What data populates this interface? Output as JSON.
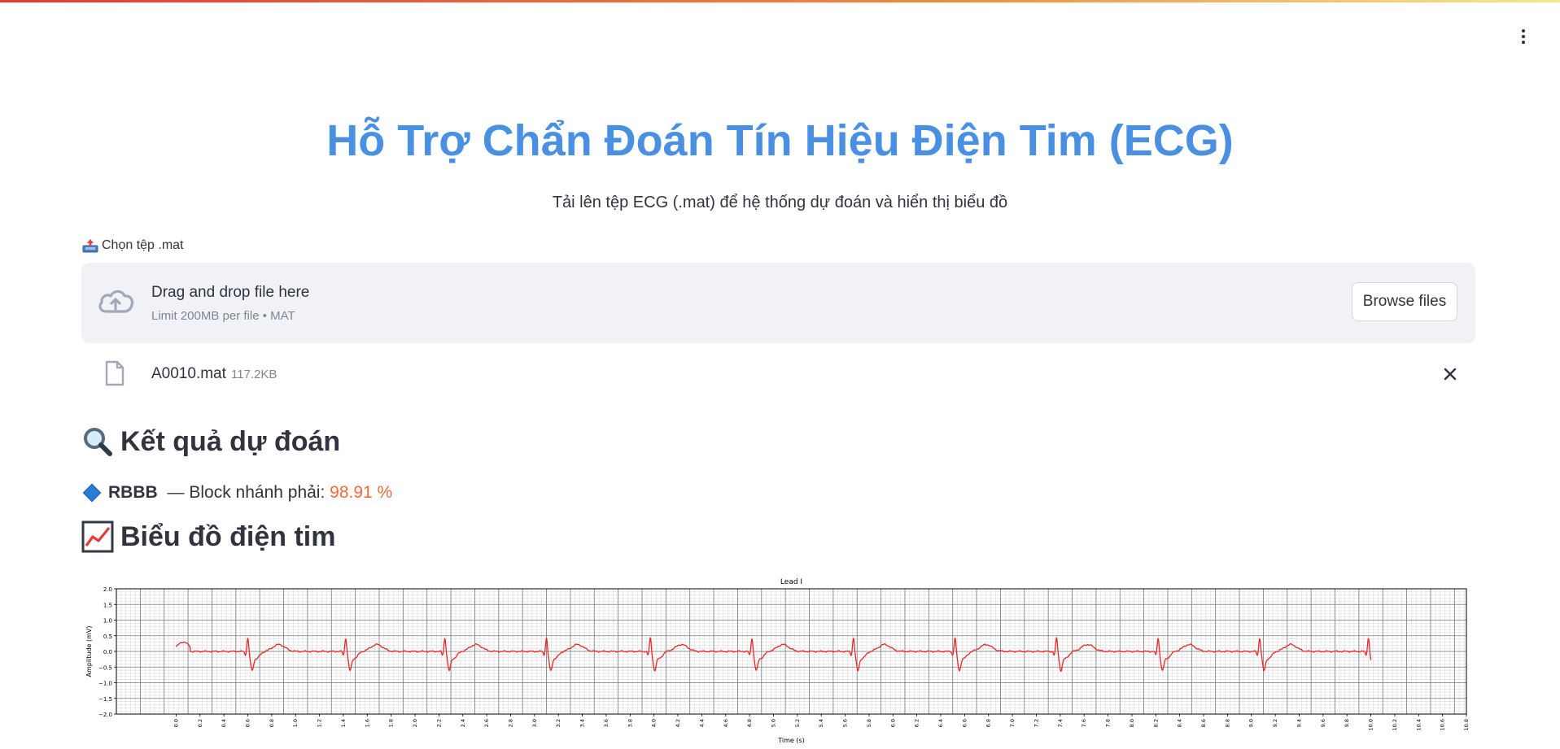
{
  "app": {
    "title": "Hỗ Trợ Chẩn Đoán Tín Hiệu Điện Tim (ECG)",
    "subtitle": "Tải lên tệp ECG (.mat) để hệ thống dự đoán và hiển thị biểu đồ",
    "accent_color": "#4a90e2"
  },
  "uploader": {
    "label": "Chọn tệp .mat",
    "label_icon": "inbox-tray-icon",
    "drop_text": "Drag and drop file here",
    "limit_text": "Limit 200MB per file • MAT",
    "browse_label": "Browse files"
  },
  "file": {
    "name": "A0010.mat",
    "size": "117.2KB"
  },
  "result": {
    "heading": "Kết quả dự đoán",
    "heading_icon": "magnifier-icon",
    "code": "RBBB",
    "separator": " — ",
    "label": "Block nhánh phải: ",
    "probability": "98.91 %",
    "prob_color": "#f06a3a"
  },
  "chart_section": {
    "heading": "Biểu đồ điện tim",
    "heading_icon": "chart-increasing-icon"
  },
  "chart_data": {
    "type": "line",
    "title": "Lead I",
    "xlabel": "Time (s)",
    "ylabel": "Amplitude (mV)",
    "xlim": [
      -0.5,
      10.8
    ],
    "ylim": [
      -2.0,
      2.0
    ],
    "x_ticks": [
      "0.0",
      "0.2",
      "0.4",
      "0.6",
      "0.8",
      "1.0",
      "1.2",
      "1.4",
      "1.6",
      "1.8",
      "2.0",
      "2.2",
      "2.4",
      "2.6",
      "2.8",
      "3.0",
      "3.2",
      "3.4",
      "3.6",
      "3.8",
      "4.0",
      "4.2",
      "4.4",
      "4.6",
      "4.8",
      "5.0",
      "5.2",
      "5.4",
      "5.6",
      "5.8",
      "6.0",
      "6.2",
      "6.4",
      "6.6",
      "6.8",
      "7.0",
      "7.2",
      "7.4",
      "7.6",
      "7.8",
      "8.0",
      "8.2",
      "8.4",
      "8.6",
      "8.8",
      "9.0",
      "9.2",
      "9.4",
      "9.6",
      "9.8",
      "10.0",
      "10.2",
      "10.4",
      "10.6",
      "10.8"
    ],
    "y_ticks": [
      "−2.0",
      "−1.5",
      "−1.0",
      "−0.5",
      "0.0",
      "0.5",
      "1.0",
      "1.5",
      "2.0"
    ],
    "grid": true,
    "line_color": "#e8262a",
    "signal_range": [
      0.0,
      10.0
    ],
    "beat_times": [
      0.6,
      1.42,
      2.25,
      3.1,
      3.97,
      4.82,
      5.67,
      6.52,
      7.37,
      8.22,
      9.07,
      9.98
    ],
    "r_peak_mv": 0.45,
    "s_trough_mv": -0.5
  }
}
